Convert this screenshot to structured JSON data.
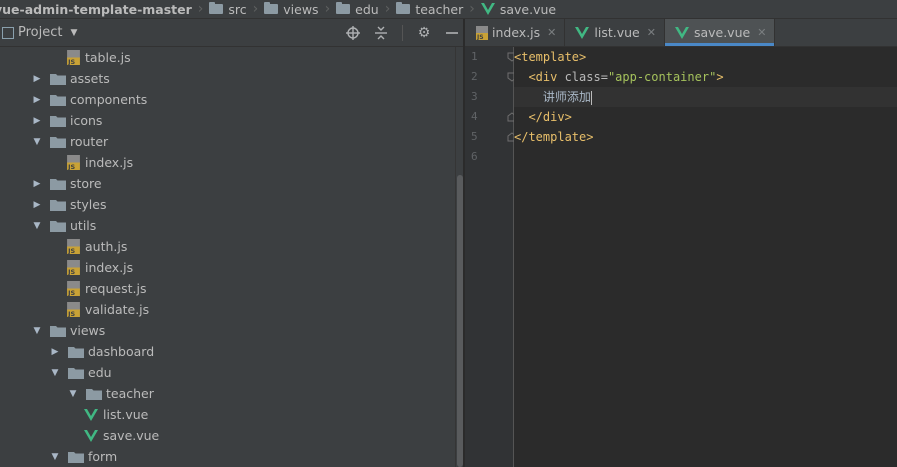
{
  "breadcrumb": {
    "items": [
      {
        "label": "vue-admin-template-master",
        "icon": "folder-icon"
      },
      {
        "label": "src",
        "icon": "folder-icon"
      },
      {
        "label": "views",
        "icon": "folder-icon"
      },
      {
        "label": "edu",
        "icon": "folder-icon"
      },
      {
        "label": "teacher",
        "icon": "folder-icon"
      },
      {
        "label": "save.vue",
        "icon": "vue-icon"
      }
    ]
  },
  "project_panel": {
    "title": "Project",
    "tools": [
      "locate-icon",
      "collapse-all-icon",
      "gear-icon",
      "hide-icon"
    ]
  },
  "tree": {
    "items": [
      {
        "label": "table.js",
        "type": "js"
      },
      {
        "label": "assets",
        "type": "folder",
        "expanded": false
      },
      {
        "label": "components",
        "type": "folder",
        "expanded": false
      },
      {
        "label": "icons",
        "type": "folder",
        "expanded": false
      },
      {
        "label": "router",
        "type": "folder",
        "expanded": true
      },
      {
        "label": "index.js",
        "type": "js"
      },
      {
        "label": "store",
        "type": "folder",
        "expanded": false
      },
      {
        "label": "styles",
        "type": "folder",
        "expanded": false
      },
      {
        "label": "utils",
        "type": "folder",
        "expanded": true
      },
      {
        "label": "auth.js",
        "type": "js"
      },
      {
        "label": "index.js",
        "type": "js"
      },
      {
        "label": "request.js",
        "type": "js"
      },
      {
        "label": "validate.js",
        "type": "js"
      },
      {
        "label": "views",
        "type": "folder",
        "expanded": true
      },
      {
        "label": "dashboard",
        "type": "folder",
        "expanded": false
      },
      {
        "label": "edu",
        "type": "folder",
        "expanded": true
      },
      {
        "label": "teacher",
        "type": "folder",
        "expanded": true
      },
      {
        "label": "list.vue",
        "type": "vue"
      },
      {
        "label": "save.vue",
        "type": "vue"
      },
      {
        "label": "form",
        "type": "folder",
        "expanded": true
      }
    ]
  },
  "tabs": [
    {
      "label": "index.js",
      "type": "js",
      "active": false
    },
    {
      "label": "list.vue",
      "type": "vue",
      "active": false
    },
    {
      "label": "save.vue",
      "type": "vue",
      "active": true
    }
  ],
  "editor": {
    "line_numbers": [
      "1",
      "2",
      "3",
      "4",
      "5",
      "6"
    ],
    "current_line": 3,
    "code": {
      "l1_tag": "<template>",
      "l2_open": "<div ",
      "l2_attr": "class=",
      "l2_val": "\"app-container\"",
      "l2_close": ">",
      "l3_text": "讲师添加",
      "l4_tag": "</div>",
      "l5_tag": "</template>"
    }
  },
  "colors": {
    "tag": "#e8bf6a",
    "string": "#a5c25c",
    "accent": "#4a88c7",
    "vue": "#41b883",
    "js": "#c9a236"
  }
}
